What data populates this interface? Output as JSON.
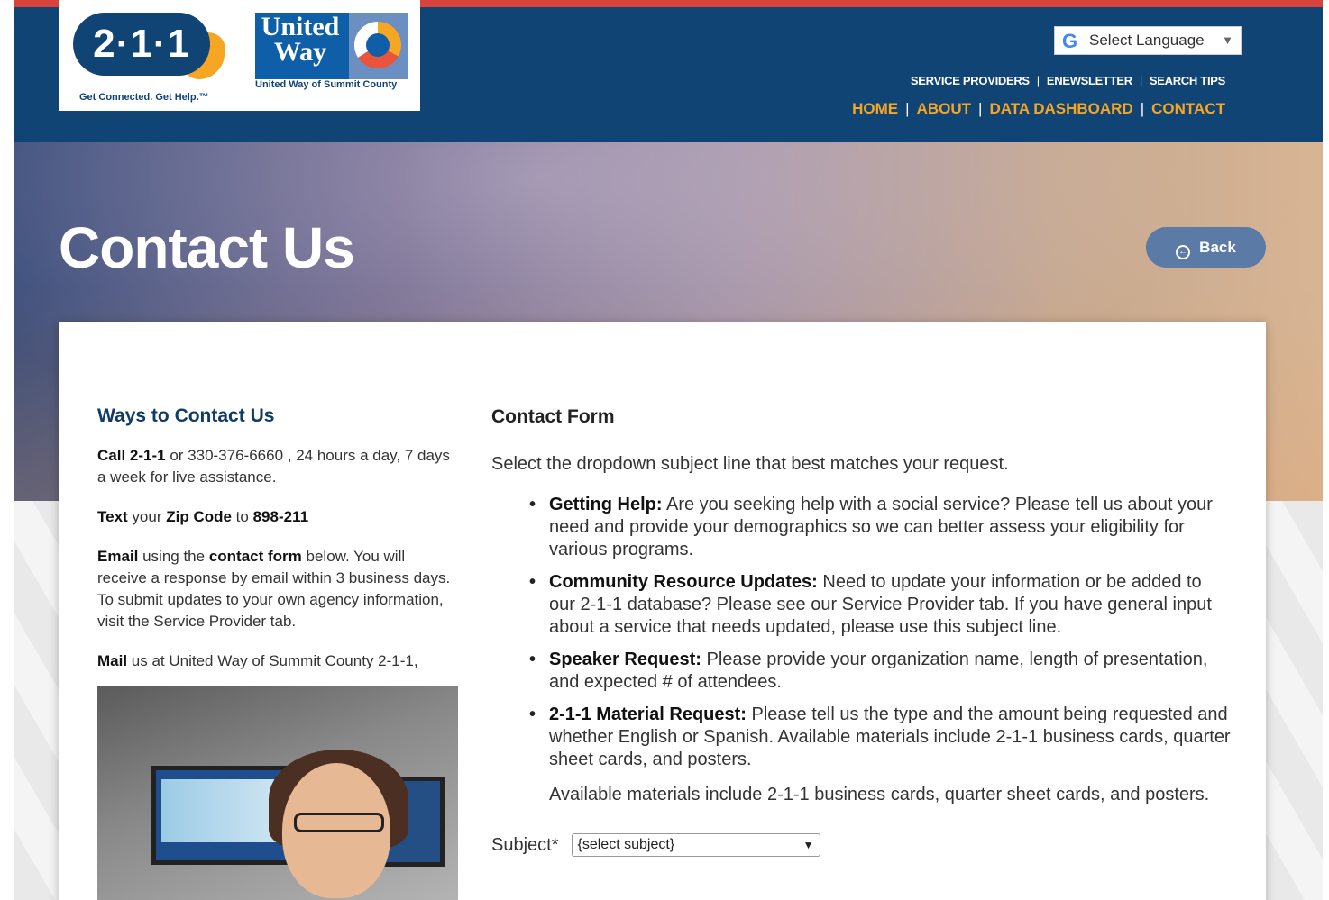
{
  "header": {
    "logo_211": {
      "number": "2·1·1",
      "tagline": "Get Connected. Get Help.™"
    },
    "logo_uw": {
      "word": "United Way",
      "tagline": "United Way of Summit County"
    },
    "language": {
      "label": "Select Language",
      "arrow": "▼"
    },
    "top_nav": [
      "SERVICE PROVIDERS",
      "ENEWSLETTER",
      "SEARCH TIPS"
    ],
    "main_nav": [
      "HOME",
      "ABOUT",
      "DATA DASHBOARD",
      "CONTACT"
    ],
    "separator": "|"
  },
  "hero": {
    "title": "Contact Us",
    "back_label": "Back"
  },
  "left": {
    "heading": "Ways to Contact Us",
    "call": {
      "strong": "Call 2-1-1",
      "rest": " or 330-376-6660 , 24 hours a day, 7 days a week for live assistance."
    },
    "text": {
      "s1": "Text",
      "m1": " your ",
      "s2": "Zip Code",
      "m2": " to ",
      "s3": "898-211"
    },
    "email": {
      "s1": "Email",
      "m1": " using the ",
      "s2": "contact form",
      "m2": " below. You will receive a response by email within 3 business days. To submit updates to your own agency information, visit the Service Provider tab."
    },
    "mail": {
      "strong": "Mail",
      "rest": " us at United Way of Summit County 2-1-1,"
    }
  },
  "form": {
    "heading": "Contact Form",
    "intro": "Select the dropdown subject line that best matches your request.",
    "items": [
      {
        "title": "Getting Help:",
        "text": " Are you seeking help with a social service? Please tell us about your need and provide your demographics so we can better assess your eligibility for various programs."
      },
      {
        "title": "Community Resource Updates:",
        "text": " Need to update your information or be added to our 2-1-1 database? Please see our Service Provider tab. If you have general input about a service that needs updated, please use this subject line."
      },
      {
        "title": "Speaker Request:",
        "text": " Please provide your organization name, length of presentation, and expected # of attendees."
      },
      {
        "title": "2-1-1 Material Request:",
        "text": " Please tell us the type and the amount being requested and whether English or Spanish. Available materials include 2-1-1 business cards, quarter sheet cards, and posters."
      }
    ],
    "extra": "Available materials include 2-1-1 business cards, quarter sheet cards, and posters.",
    "subject_label": "Subject*",
    "subject_value": "{select subject}"
  },
  "colors": {
    "nav_blue": "#0f4475",
    "accent_orange": "#f6a623",
    "top_red": "#d8433b",
    "back_button": "#5c7aa6"
  }
}
